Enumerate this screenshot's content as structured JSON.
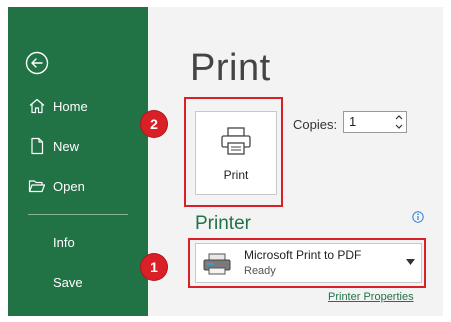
{
  "sidebar": {
    "items": [
      {
        "label": "Home",
        "icon": "home-icon"
      },
      {
        "label": "New",
        "icon": "new-document-icon"
      },
      {
        "label": "Open",
        "icon": "folder-open-icon"
      },
      {
        "label": "Info",
        "icon": ""
      },
      {
        "label": "Save",
        "icon": ""
      }
    ],
    "back_icon": "back-arrow-icon",
    "background": "#217346"
  },
  "main": {
    "title": "Print",
    "print_button_label": "Print",
    "copies_label": "Copies:",
    "copies_value": "1",
    "printer_section_title": "Printer",
    "printer_name": "Microsoft Print to PDF",
    "printer_status": "Ready",
    "printer_properties_link": "Printer Properties"
  },
  "callouts": [
    {
      "number": "1"
    },
    {
      "number": "2"
    }
  ],
  "colors": {
    "accent": "#217346",
    "highlight": "#d92027"
  }
}
